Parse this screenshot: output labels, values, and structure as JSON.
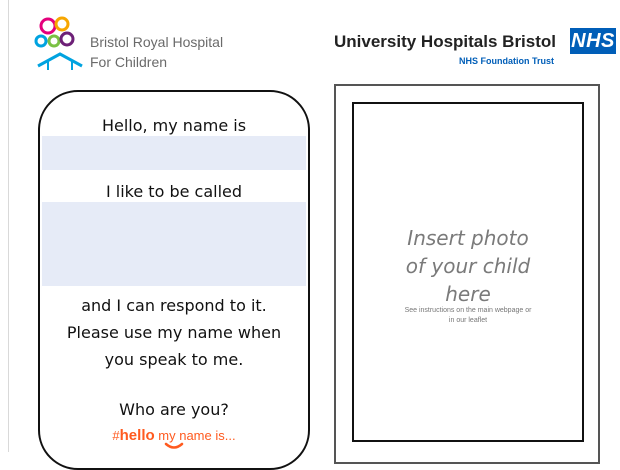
{
  "header": {
    "left_logo": {
      "line1": "Bristol Royal Hospital",
      "line2": "For Children"
    },
    "right_logo": {
      "name": "University Hospitals Bristol",
      "badge": "NHS",
      "trust": "NHS Foundation Trust",
      "badge_color": "#005eb8"
    }
  },
  "card": {
    "hello_line": "Hello, my name is",
    "called_line": "I like to be called",
    "respond_lines": [
      "and I can respond to it.",
      "Please use my name when",
      "you speak to me."
    ],
    "who_line": "Who are you?",
    "hashtag": {
      "hash": "#",
      "hello": "hello",
      "rest": "my name is..."
    },
    "field_color": "#e6ebf7",
    "accent_color": "#ff5a1f"
  },
  "photo": {
    "prompt_lines": [
      "Insert photo",
      "of your child",
      "here"
    ],
    "note_lines": [
      "See instructions on the main webpage or",
      "in our leaflet"
    ]
  }
}
